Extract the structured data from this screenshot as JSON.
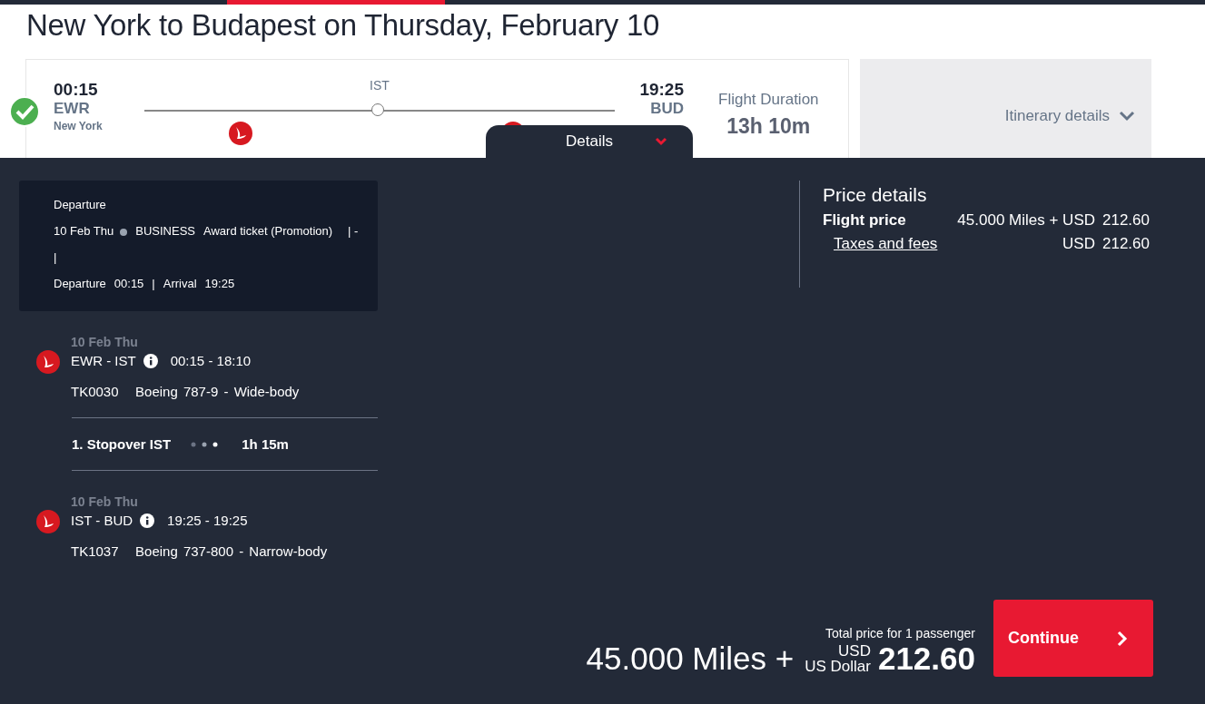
{
  "title": "New York to Budapest on Thursday, February 10",
  "flight": {
    "departure": {
      "time": "00:15",
      "code": "EWR",
      "city": "New York"
    },
    "stop": "IST",
    "arrival": {
      "time": "19:25",
      "code": "BUD"
    },
    "duration_label": "Flight Duration",
    "duration": "13h 10m",
    "selected": true
  },
  "itinerary_details": "Itinerary details",
  "details_tab": {
    "label": "Details",
    "expanded": true
  },
  "summary": {
    "heading": "Departure",
    "date": "10 Feb Thu",
    "cabin": "BUSINESS",
    "fare": "Award ticket (Promotion)",
    "extra": "| -",
    "extra_2": "|",
    "dep_label": "Departure",
    "dep_time": "00:15",
    "separator": "|",
    "arr_label": "Arrival",
    "arr_time": "19:25"
  },
  "segments": [
    {
      "kind": "flight",
      "date": "10 Feb Thu",
      "route": "EWR - IST",
      "times": "00:15 - 18:10",
      "flight_no": "TK0030",
      "aircraft": "Boeing 787-9 - Wide-body"
    },
    {
      "kind": "stopover",
      "label": "1. Stopover IST",
      "duration": "1h 15m"
    },
    {
      "kind": "flight",
      "date": "10 Feb Thu",
      "route": "IST - BUD",
      "times": "19:25 - 19:25",
      "flight_no": "TK1037",
      "aircraft": "Boeing 737-800 - Narrow-body"
    }
  ],
  "price_details": {
    "title": "Price details",
    "rows": [
      {
        "kind": "plain",
        "label": "Flight price",
        "currency": "45.000 Miles + USD",
        "amount": "212.60"
      },
      {
        "kind": "link",
        "label": "Taxes and fees",
        "currency": "USD",
        "amount": "212.60"
      }
    ]
  },
  "total": {
    "caption": "Total price for 1 passenger",
    "miles": "45.000 Miles +",
    "currency": "USD",
    "currency_name": "US Dollar",
    "amount": "212.60",
    "button": "Continue"
  }
}
